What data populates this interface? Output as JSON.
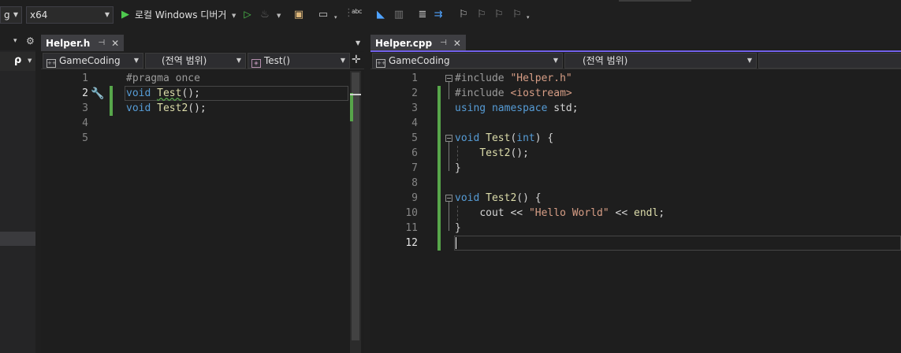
{
  "toolbar": {
    "config_value": "g",
    "platform_value": "x64",
    "run_label": "로컬 Windows 디버거",
    "spell_icon_text": "abc"
  },
  "left_panel": {
    "pin_glyph": "▾",
    "gear_glyph": "⚙",
    "search_glyph": "ρ"
  },
  "pane_h": {
    "tab_title": "Helper.h",
    "project_combo": "GameCoding",
    "scope_combo": "(전역 범위)",
    "member_combo": "Test()",
    "lines": [
      {
        "num": "1",
        "text": "#pragma once"
      },
      {
        "num": "2",
        "text_kw": "void",
        "text_fn": "Test",
        "text_rest": "();"
      },
      {
        "num": "3",
        "text_kw": "void",
        "text_fn": "Test2",
        "text_rest": "();"
      },
      {
        "num": "4"
      },
      {
        "num": "5"
      }
    ]
  },
  "pane_cpp": {
    "tab_title": "Helper.cpp",
    "project_combo": "GameCoding",
    "scope_combo": "(전역 범위)",
    "lines": [
      {
        "num": "1"
      },
      {
        "num": "2"
      },
      {
        "num": "3"
      },
      {
        "num": "4"
      },
      {
        "num": "5"
      },
      {
        "num": "6"
      },
      {
        "num": "7"
      },
      {
        "num": "8"
      },
      {
        "num": "9"
      },
      {
        "num": "10"
      },
      {
        "num": "11"
      },
      {
        "num": "12"
      }
    ],
    "code": {
      "inc1_pp": "#include",
      "inc1_str": "\"Helper.h\"",
      "inc2_pp": "#include",
      "inc2_str": "<iostream>",
      "using_kw": "using",
      "namespace_kw": "namespace",
      "std": "std;",
      "void1": "void",
      "test1": "Test",
      "int_kw": "int",
      "test1_tail": ") {",
      "test2_call": "Test2",
      "test2_call_tail": "();",
      "close1": "}",
      "void2": "void",
      "test2_def": "Test2",
      "test2_def_tail": "() {",
      "cout": "cout <<",
      "hello": "\"Hello World\"",
      "endl_pre": "<<",
      "endl": "endl",
      "endl_tail": ";",
      "close2": "}"
    }
  },
  "colors": {
    "keyword": "#569cd6",
    "string": "#d69d85",
    "function": "#dcdcaa",
    "change_bar": "#57a64a",
    "active_tab": "#3e3e42",
    "active_accent": "#7160e8"
  }
}
